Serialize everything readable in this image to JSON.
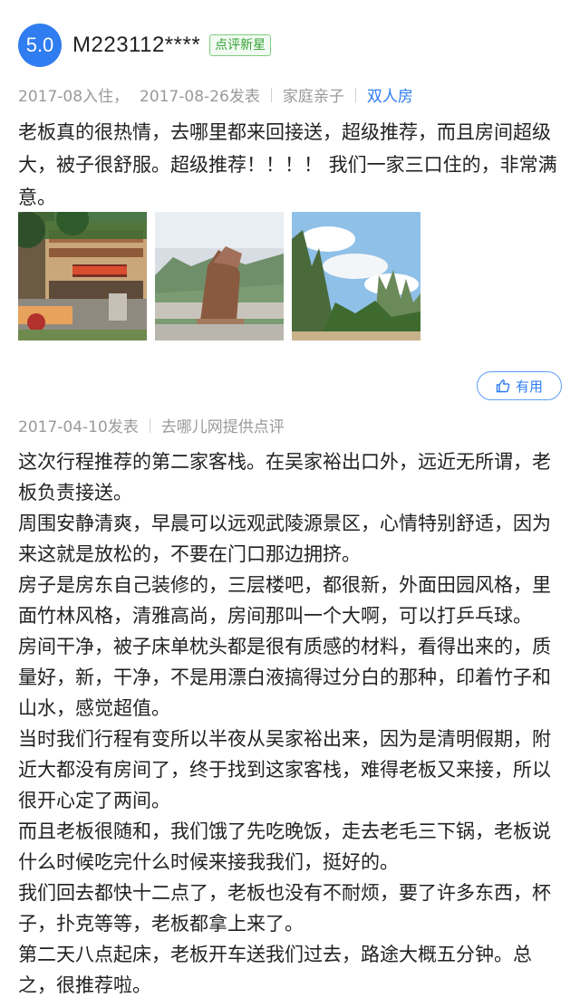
{
  "review1": {
    "score": "5.0",
    "username": "M223112****",
    "badge": "点评新星",
    "checkin": "2017-08入住，",
    "posted": "2017-08-26发表",
    "trip_type": "家庭亲子",
    "room_type": "双人房",
    "text": "老板真的很热情，去哪里都来回接送，超级推荐，而且房间超级大，被子很舒服。超级推荐！！！！ 我们一家三口住的，非常满意。"
  },
  "helpful_button": {
    "label": "有用",
    "icon": "thumbs-up-icon",
    "color": "#2f7df0"
  },
  "review2": {
    "posted": "2017-04-10发表",
    "source": "去哪儿网提供点评",
    "paragraphs": [
      "这次行程推荐的第二家客栈。在吴家裕出口外，远近无所谓，老板负责接送。",
      "周围安静清爽，早晨可以远观武陵源景区，心情特别舒适，因为来这就是放松的，不要在门口那边拥挤。",
      "房子是房东自己装修的，三层楼吧，都很新，外面田园风格，里面竹林风格，清雅高尚，房间那叫一个大啊，可以打乒乓球。",
      "房间干净，被子床单枕头都是很有质感的材料，看得出来的，质量好，新，干净，不是用漂白液搞得过分白的那种，印着竹子和山水，感觉超值。",
      "当时我们行程有变所以半夜从吴家裕出来，因为是清明假期，附近大都没有房间了，终于找到这家客栈，难得老板又来接，所以很开心定了两间。",
      "而且老板很随和，我们饿了先吃晚饭，走去老毛三下锅，老板说什么时候吃完什么时候来接我我们，挺好的。",
      "我们回去都快十二点了，老板也没有不耐烦，要了许多东西，杯子，扑克等等，老板都拿上来了。",
      "第二天八点起床，老板开车送我们过去，路途大概五分钟。总之，很推荐啦。"
    ]
  },
  "colors": {
    "accent": "#2f7df0",
    "badge_green": "#33a033",
    "meta_gray": "#9a9a9a"
  }
}
